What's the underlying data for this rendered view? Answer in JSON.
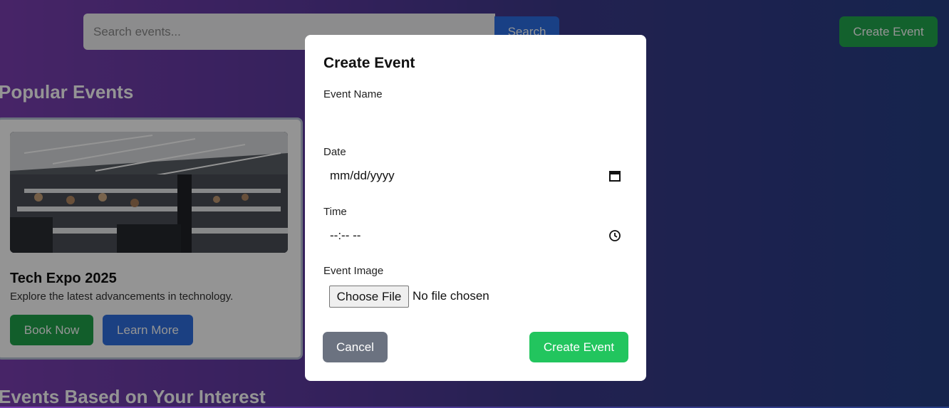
{
  "header": {
    "search_placeholder": "Search events...",
    "search_button": "Search",
    "create_event_button": "Create Event"
  },
  "sections": {
    "popular_title": "Popular Events",
    "interest_title": "Events Based on Your Interest"
  },
  "event_card": {
    "title": "Tech Expo 2025",
    "description": "Explore the latest advancements in technology.",
    "book_label": "Book Now",
    "learn_label": "Learn More",
    "image_icon": "conference-hall-photo"
  },
  "modal": {
    "title": "Create Event",
    "name_label": "Event Name",
    "name_value": "",
    "date_label": "Date",
    "date_value": "mm/dd/yyyy",
    "time_label": "Time",
    "time_value": "--:-- --",
    "image_label": "Event Image",
    "choose_file_label": "Choose File",
    "file_status": "No file chosen",
    "cancel_label": "Cancel",
    "submit_label": "Create Event"
  },
  "colors": {
    "primary_green": "#22c55e",
    "primary_blue": "#2b6fe6",
    "cancel_gray": "#6b7280"
  }
}
